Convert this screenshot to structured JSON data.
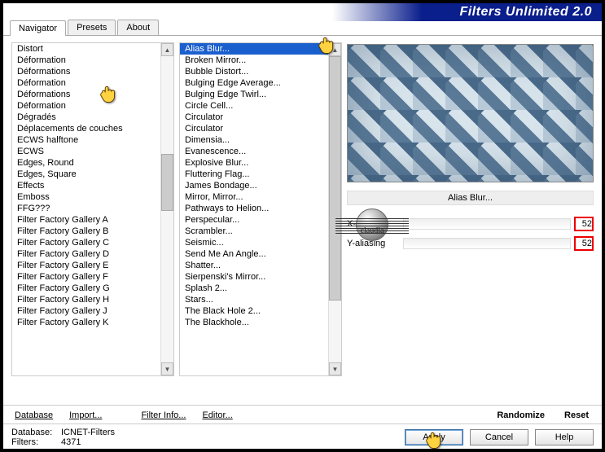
{
  "app": {
    "title": "Filters Unlimited 2.0"
  },
  "tabs": [
    {
      "label": "Navigator"
    },
    {
      "label": "Presets"
    },
    {
      "label": "About"
    }
  ],
  "categories": [
    "Distort",
    "Déformation",
    "Déformations",
    "Déformation",
    "Déformations",
    "Déformation",
    "Dégradés",
    "Déplacements de couches",
    "ECWS halftone",
    "ECWS",
    "Edges, Round",
    "Edges, Square",
    "Effects",
    "Emboss",
    "FFG???",
    "Filter Factory Gallery A",
    "Filter Factory Gallery B",
    "Filter Factory Gallery C",
    "Filter Factory Gallery D",
    "Filter Factory Gallery E",
    "Filter Factory Gallery F",
    "Filter Factory Gallery G",
    "Filter Factory Gallery H",
    "Filter Factory Gallery J",
    "Filter Factory Gallery K"
  ],
  "filters": [
    "Alias Blur...",
    "Broken Mirror...",
    "Bubble Distort...",
    "Bulging Edge Average...",
    "Bulging Edge Twirl...",
    "Circle Cell...",
    "Circulator",
    "Circulator",
    "Dimensia...",
    "Evanescence...",
    "Explosive Blur...",
    "Fluttering Flag...",
    "James Bondage...",
    "Mirror, Mirror...",
    "Pathways to Helion...",
    "Perspecular...",
    "Scrambler...",
    "Seismic...",
    "Send Me An Angle...",
    "Shatter...",
    "Sierpenski's Mirror...",
    "Splash 2...",
    "Stars...",
    "The Black Hole 2...",
    "The Blackhole..."
  ],
  "selected_filter": "Alias Blur...",
  "params": {
    "x": {
      "label": "X-aliasing",
      "value": "52"
    },
    "y": {
      "label": "Y-aliasing",
      "value": "52"
    }
  },
  "row1": {
    "database": "Database",
    "import": "Import...",
    "filterinfo": "Filter Info...",
    "editor": "Editor...",
    "randomize": "Randomize",
    "reset": "Reset"
  },
  "status": {
    "db_label": "Database:",
    "db_value": "ICNET-Filters",
    "fl_label": "Filters:",
    "fl_value": "4371"
  },
  "buttons": {
    "apply": "Apply",
    "cancel": "Cancel",
    "help": "Help"
  },
  "watermark": {
    "text": "claudia"
  }
}
